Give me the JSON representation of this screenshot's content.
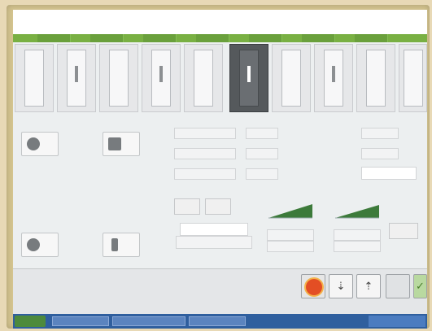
{
  "colors": {
    "accent_green": "#79b043",
    "estop_red": "#e34e24",
    "active_tile": "#55595c",
    "taskbar": "#2f5f9e"
  },
  "header": {
    "tabs": [
      "",
      "",
      "",
      "",
      "",
      "",
      "",
      ""
    ]
  },
  "tiles": {
    "items": [
      "",
      "",
      "",
      "",
      "",
      "",
      "",
      "",
      "",
      ""
    ],
    "active_index": 6,
    "caption_left": "",
    "caption_mid": ""
  },
  "settings": {
    "heading": "",
    "rows": [
      "",
      "",
      ""
    ],
    "right_labels": [
      "",
      "",
      ""
    ],
    "right_field_value": ""
  },
  "ramps": {
    "label_left": "",
    "label_right": "",
    "buttons": [
      "",
      ""
    ]
  },
  "icons": {
    "top_left_label": "",
    "top_mid_label": "",
    "bottom_left_label": "",
    "bottom_mid_label": ""
  },
  "status": {
    "line1": "",
    "line2": ""
  },
  "controls": {
    "estop": "emergency-stop",
    "step": "step-icon",
    "jog": "jog-icon",
    "blank": "",
    "ok": "checkmark-icon"
  },
  "taskbar": {
    "items": [
      "",
      "",
      ""
    ]
  }
}
